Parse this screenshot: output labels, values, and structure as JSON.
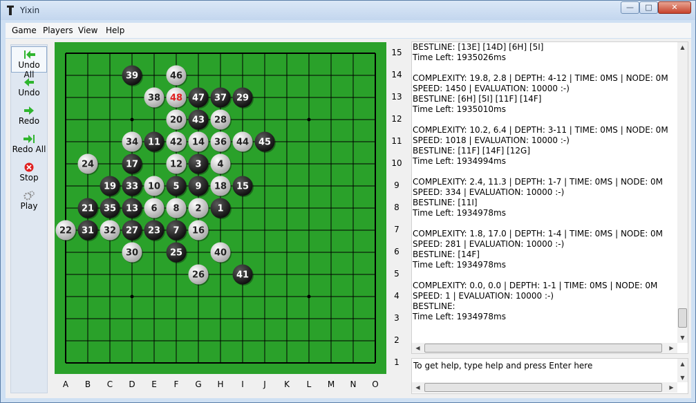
{
  "window": {
    "title": "Yixin"
  },
  "titlebar_buttons": {
    "minimize": "—",
    "maximize": "□",
    "close": "✕"
  },
  "menu": [
    "Game",
    "Players",
    "View",
    "Help"
  ],
  "toolbar": [
    {
      "label": "Undo All",
      "icon": "undo-all-icon",
      "color": "#2fb52f"
    },
    {
      "label": "Undo",
      "icon": "undo-icon",
      "color": "#2fb52f"
    },
    {
      "label": "Redo",
      "icon": "redo-icon",
      "color": "#2fb52f"
    },
    {
      "label": "Redo All",
      "icon": "redo-all-icon",
      "color": "#2fb52f"
    },
    {
      "label": "Stop",
      "icon": "stop-icon",
      "color": "#e02020"
    },
    {
      "label": "Play",
      "icon": "gear-icon",
      "color": "#8a8a8a"
    }
  ],
  "board": {
    "size": 15,
    "colors": {
      "board": "#2aa12a",
      "black_stone": "#111111",
      "white_stone": "#e6e6e6",
      "last_move": "#e02020"
    },
    "columns": [
      "A",
      "B",
      "C",
      "D",
      "E",
      "F",
      "G",
      "H",
      "I",
      "J",
      "K",
      "L",
      "M",
      "N",
      "O"
    ],
    "rows": [
      "15",
      "14",
      "13",
      "12",
      "11",
      "10",
      "9",
      "8",
      "7",
      "6",
      "5",
      "4",
      "3",
      "2",
      "1"
    ],
    "last_move": 48,
    "stones": [
      {
        "n": "1",
        "c": "H",
        "r": 8,
        "color": "black"
      },
      {
        "n": "2",
        "c": "G",
        "r": 8,
        "color": "white"
      },
      {
        "n": "3",
        "c": "G",
        "r": 10,
        "color": "black"
      },
      {
        "n": "4",
        "c": "H",
        "r": 10,
        "color": "white"
      },
      {
        "n": "5",
        "c": "F",
        "r": 9,
        "color": "black"
      },
      {
        "n": "6",
        "c": "E",
        "r": 8,
        "color": "white"
      },
      {
        "n": "7",
        "c": "F",
        "r": 7,
        "color": "black"
      },
      {
        "n": "8",
        "c": "F",
        "r": 8,
        "color": "white"
      },
      {
        "n": "9",
        "c": "G",
        "r": 9,
        "color": "black"
      },
      {
        "n": "10",
        "c": "E",
        "r": 9,
        "color": "white"
      },
      {
        "n": "11",
        "c": "E",
        "r": 11,
        "color": "black"
      },
      {
        "n": "12",
        "c": "F",
        "r": 10,
        "color": "white"
      },
      {
        "n": "13",
        "c": "D",
        "r": 8,
        "color": "black"
      },
      {
        "n": "14",
        "c": "G",
        "r": 11,
        "color": "white"
      },
      {
        "n": "15",
        "c": "I",
        "r": 9,
        "color": "black"
      },
      {
        "n": "16",
        "c": "G",
        "r": 7,
        "color": "white"
      },
      {
        "n": "17",
        "c": "D",
        "r": 10,
        "color": "black"
      },
      {
        "n": "18",
        "c": "H",
        "r": 9,
        "color": "white"
      },
      {
        "n": "19",
        "c": "C",
        "r": 9,
        "color": "black"
      },
      {
        "n": "20",
        "c": "F",
        "r": 12,
        "color": "white"
      },
      {
        "n": "21",
        "c": "B",
        "r": 8,
        "color": "black"
      },
      {
        "n": "22",
        "c": "A",
        "r": 7,
        "color": "white"
      },
      {
        "n": "23",
        "c": "E",
        "r": 7,
        "color": "black"
      },
      {
        "n": "24",
        "c": "B",
        "r": 10,
        "color": "white"
      },
      {
        "n": "25",
        "c": "F",
        "r": 6,
        "color": "black"
      },
      {
        "n": "26",
        "c": "G",
        "r": 5,
        "color": "white"
      },
      {
        "n": "27",
        "c": "D",
        "r": 7,
        "color": "black"
      },
      {
        "n": "28",
        "c": "H",
        "r": 12,
        "color": "white"
      },
      {
        "n": "29",
        "c": "I",
        "r": 13,
        "color": "black"
      },
      {
        "n": "30",
        "c": "D",
        "r": 6,
        "color": "white"
      },
      {
        "n": "31",
        "c": "B",
        "r": 7,
        "color": "black"
      },
      {
        "n": "32",
        "c": "C",
        "r": 7,
        "color": "white"
      },
      {
        "n": "33",
        "c": "D",
        "r": 9,
        "color": "black"
      },
      {
        "n": "34",
        "c": "D",
        "r": 11,
        "color": "white"
      },
      {
        "n": "35",
        "c": "C",
        "r": 8,
        "color": "black"
      },
      {
        "n": "36",
        "c": "H",
        "r": 11,
        "color": "white"
      },
      {
        "n": "37",
        "c": "H",
        "r": 13,
        "color": "black"
      },
      {
        "n": "38",
        "c": "E",
        "r": 13,
        "color": "white"
      },
      {
        "n": "39",
        "c": "D",
        "r": 14,
        "color": "black"
      },
      {
        "n": "40",
        "c": "H",
        "r": 6,
        "color": "white"
      },
      {
        "n": "41",
        "c": "I",
        "r": 5,
        "color": "black"
      },
      {
        "n": "42",
        "c": "F",
        "r": 11,
        "color": "white"
      },
      {
        "n": "43",
        "c": "G",
        "r": 12,
        "color": "black"
      },
      {
        "n": "44",
        "c": "I",
        "r": 11,
        "color": "white"
      },
      {
        "n": "45",
        "c": "J",
        "r": 11,
        "color": "black"
      },
      {
        "n": "46",
        "c": "F",
        "r": 14,
        "color": "white"
      },
      {
        "n": "47",
        "c": "G",
        "r": 13,
        "color": "black"
      },
      {
        "n": "48",
        "c": "F",
        "r": 13,
        "color": "white"
      }
    ]
  },
  "log": [
    "BESTLINE: [13E] [14D] [6H] [5I]",
    "Time Left: 1935026ms",
    "",
    "COMPLEXITY: 19.8, 2.8 | DEPTH: 4-12 | TIME: 0MS | NODE: 0M",
    "SPEED: 1450 | EVALUATION: 10000 :-)",
    "BESTLINE: [6H] [5I] [11F] [14F]",
    "Time Left: 1935010ms",
    "",
    "COMPLEXITY: 10.2, 6.4 | DEPTH: 3-11 | TIME: 0MS | NODE: 0M",
    "SPEED: 1018 | EVALUATION: 10000 :-)",
    "BESTLINE: [11F] [14F] [12G]",
    "Time Left: 1934994ms",
    "",
    "COMPLEXITY: 2.4, 11.3 | DEPTH: 1-7 | TIME: 0MS | NODE: 0M",
    "SPEED: 334 | EVALUATION: 10000 :-)",
    "BESTLINE: [11I]",
    "Time Left: 1934978ms",
    "",
    "COMPLEXITY: 1.8, 17.0 | DEPTH: 1-4 | TIME: 0MS | NODE: 0M",
    "SPEED: 281 | EVALUATION: 10000 :-)",
    "BESTLINE: [14F]",
    "Time Left: 1934978ms",
    "",
    "COMPLEXITY: 0.0, 0.0 | DEPTH: 1-1 | TIME: 0MS | NODE: 0M",
    "SPEED: 1 | EVALUATION: 10000 :-)",
    "BESTLINE:",
    "Time Left: 1934978ms"
  ],
  "command": {
    "value": "To get help, type help and press Enter here"
  }
}
